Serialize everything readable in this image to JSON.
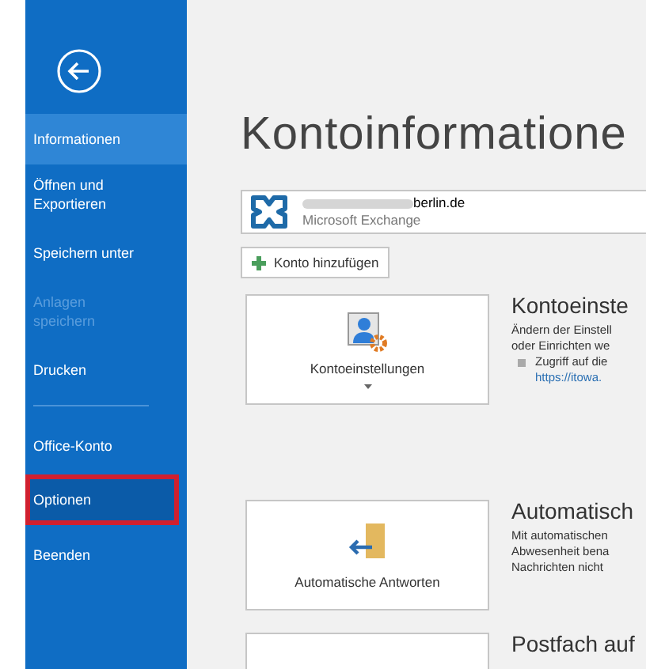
{
  "sidebar": {
    "items": [
      {
        "label": "Informationen",
        "selected": true,
        "disabled": false,
        "marked": false
      },
      {
        "label": "Öffnen und Exportieren",
        "selected": false,
        "disabled": false,
        "marked": false
      },
      {
        "label": "Speichern unter",
        "selected": false,
        "disabled": false,
        "marked": false
      },
      {
        "label": "Anlagen speichern",
        "selected": false,
        "disabled": true,
        "marked": false
      },
      {
        "label": "Drucken",
        "selected": false,
        "disabled": false,
        "marked": false,
        "divider_after": true
      },
      {
        "label": "Office-Konto",
        "selected": false,
        "disabled": false,
        "marked": false
      },
      {
        "label": "Optionen",
        "selected": false,
        "disabled": false,
        "marked": true
      },
      {
        "label": "Beenden",
        "selected": false,
        "disabled": false,
        "marked": false
      }
    ]
  },
  "page_title": "Kontoinformatione",
  "account": {
    "email": "berlin.de",
    "type": "Microsoft Exchange"
  },
  "add_account_button": "Konto hinzufügen",
  "sections": [
    {
      "kind": "settings",
      "button": "Kontoeinstellungen",
      "has_dropdown": true,
      "heading": "Kontoeinste",
      "lines": [
        "Ändern der Einstell",
        "oder Einrichten we"
      ],
      "bullet": "Zugriff auf die",
      "link": "https://itowa."
    },
    {
      "kind": "reply",
      "button": "Automatische Antworten",
      "has_dropdown": false,
      "heading": "Automatisch",
      "lines": [
        "Mit automatischen",
        "Abwesenheit bena",
        "Nachrichten nicht"
      ]
    },
    {
      "kind": "mailbox",
      "heading": "Postfach auf"
    }
  ]
}
